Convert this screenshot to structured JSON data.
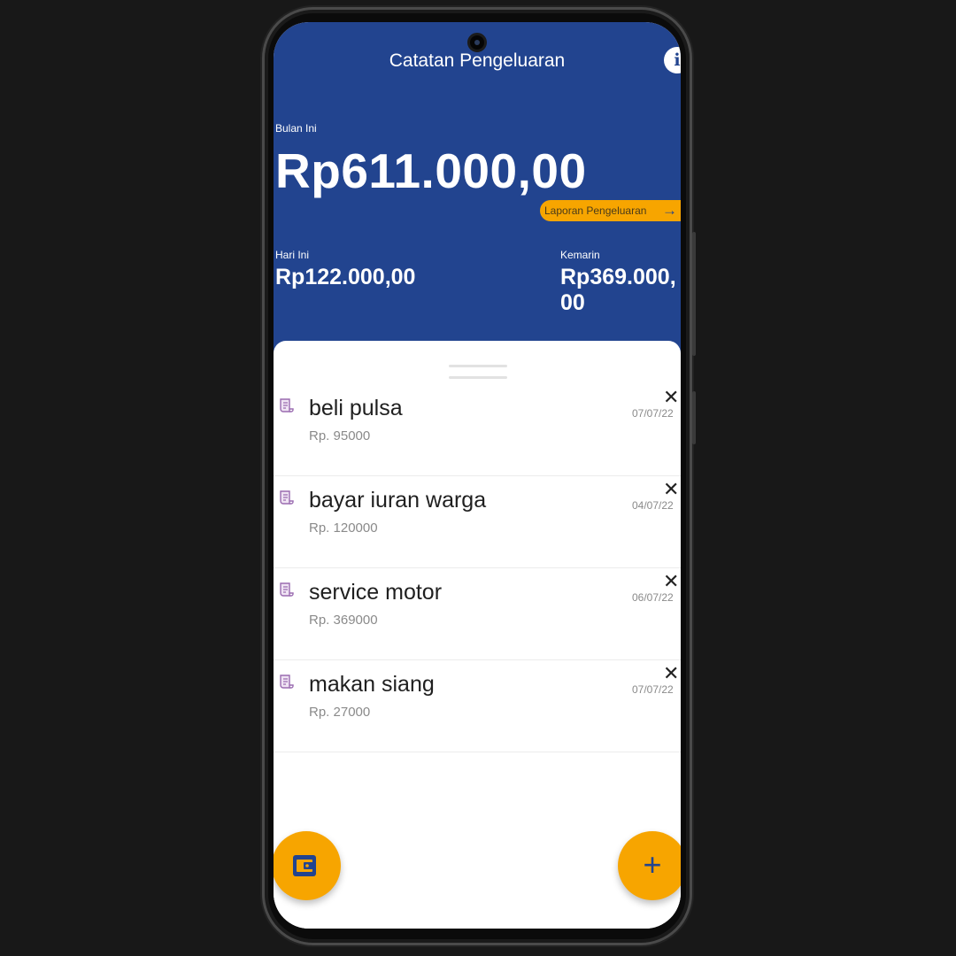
{
  "app": {
    "title": "Catatan Pengeluaran",
    "info_label": "i"
  },
  "summary": {
    "month_label": "Bulan Ini",
    "month_total": "Rp611.000,00",
    "report_button": "Laporan Pengeluaran",
    "today_label": "Hari Ini",
    "today_total": "Rp122.000,00",
    "yesterday_label": "Kemarin",
    "yesterday_total": "Rp369.000,00"
  },
  "expenses": [
    {
      "name": "beli pulsa",
      "amount": "Rp. 95000",
      "date": "07/07/22"
    },
    {
      "name": "bayar iuran warga",
      "amount": "Rp. 120000",
      "date": "04/07/22"
    },
    {
      "name": "service motor",
      "amount": "Rp. 369000",
      "date": "06/07/22"
    },
    {
      "name": "makan siang",
      "amount": "Rp. 27000",
      "date": "07/07/22"
    }
  ],
  "actions": {
    "add_label": "+",
    "delete_label": "✕"
  },
  "colors": {
    "primary": "#22448f",
    "accent": "#f7a500",
    "background": "#ffffff"
  },
  "icons": {
    "list_item": "receipt-icon",
    "wallet_button": "wallet-icon",
    "info_button": "info-icon"
  }
}
